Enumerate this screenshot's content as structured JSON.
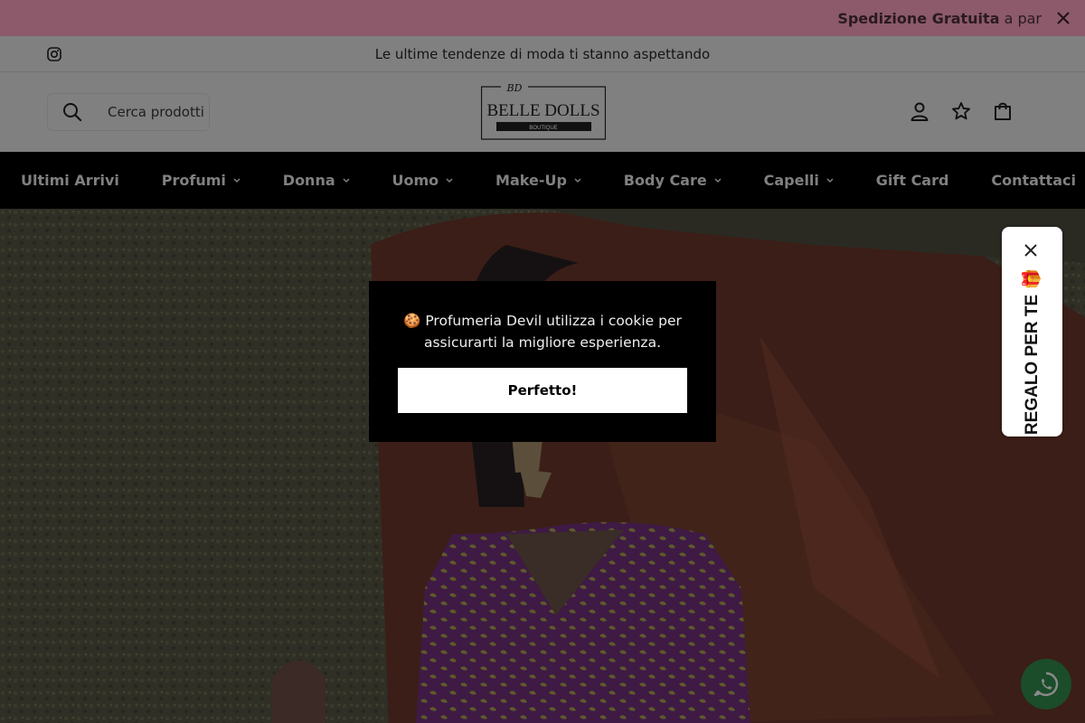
{
  "promo": {
    "bold_text": "Spedizione Gratuita",
    "rest_text": " a par",
    "background": "#8c5a6a"
  },
  "announcement": {
    "text": "Le ultime tendenze di moda ti stanno aspettando"
  },
  "header": {
    "search_placeholder": "Cerca prodotti",
    "logo": {
      "brand": "BELLE DOLLS",
      "sub": "BOUTIQUE",
      "monogram": "BD"
    },
    "icons": [
      "user-icon",
      "star-icon",
      "bag-icon"
    ]
  },
  "nav": {
    "items": [
      {
        "label": "Ultimi Arrivi",
        "dropdown": false
      },
      {
        "label": "Profumi",
        "dropdown": true
      },
      {
        "label": "Donna",
        "dropdown": true
      },
      {
        "label": "Uomo",
        "dropdown": true
      },
      {
        "label": "Make-Up",
        "dropdown": true
      },
      {
        "label": "Body Care",
        "dropdown": true
      },
      {
        "label": "Capelli",
        "dropdown": true
      },
      {
        "label": "Gift Card",
        "dropdown": false
      },
      {
        "label": "Contattaci",
        "dropdown": false
      }
    ]
  },
  "cookie_banner": {
    "emoji": "🍪",
    "text": "Profumeria Devil utilizza i cookie per assicurarti la migliore esperienza.",
    "button_label": "Perfetto!"
  },
  "gift_tab": {
    "label": "REGALO PER TE",
    "emoji": "🎁"
  },
  "colors": {
    "overlay": "#000000",
    "nav_background": "#000000",
    "whatsapp": "#1b4d2a"
  }
}
